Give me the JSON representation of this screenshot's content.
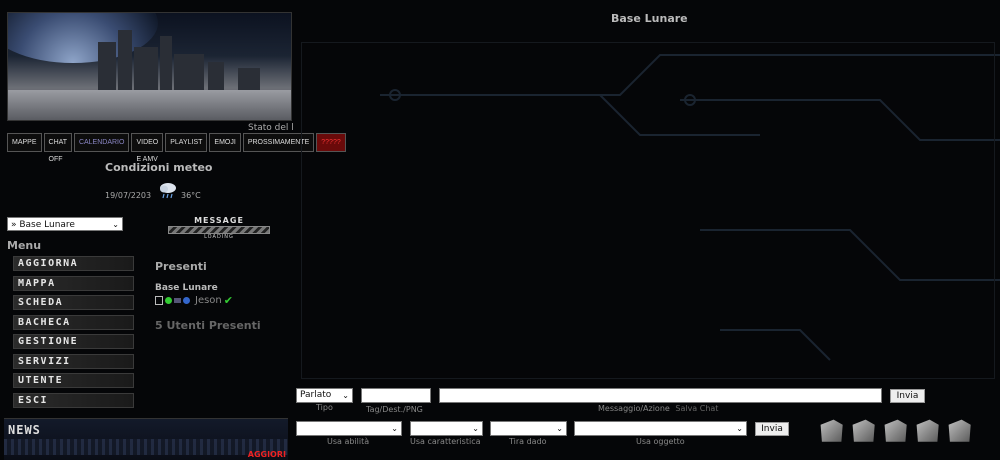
{
  "header": {
    "stato_label": "Stato del l"
  },
  "nav": [
    "MAPPE",
    "CHAT OFF",
    "CALENDARIO",
    "VIDEO E AMV",
    "PLAYLIST",
    "EMOJI",
    "PROSSIMAMENTE",
    "?????"
  ],
  "meteo": {
    "title": "Condizioni meteo",
    "date": "19/07/2203",
    "temp": "36°C",
    "icon": "rain-cloud-icon"
  },
  "location_select": {
    "value": "» Base Lunare"
  },
  "message_widget": {
    "title": "MESSAGE",
    "status": "LOADING"
  },
  "menu": {
    "title": "Menu",
    "items": [
      "AGGIORNA",
      "MAPPA",
      "SCHEDA",
      "BACHECA",
      "GESTIONE",
      "SERVIZI",
      "UTENTE",
      "ESCI"
    ]
  },
  "presenti": {
    "title": "Presenti",
    "location": "Base Lunare",
    "user": "Jeson",
    "count_label": "5 Utenti Presenti"
  },
  "news": {
    "title": "NEWS",
    "update": "AGGIORI"
  },
  "chat": {
    "title": "Base Lunare"
  },
  "form1": {
    "tipo_value": "Parlato",
    "tipo_label": "Tipo",
    "tag_label": "Tag/Dest./PNG",
    "messaggio_label": "Messaggio/Azione",
    "salva_label": "Salva Chat",
    "send": "Invia"
  },
  "form2": {
    "abilita_label": "Usa abilità",
    "caratteristica_label": "Usa caratteristica",
    "dado_label": "Tira dado",
    "oggetto_label": "Usa oggetto",
    "send": "Invia"
  },
  "colors": {
    "background": "#050608",
    "accent_red": "#e22222",
    "calendar": "#8a86c4"
  }
}
